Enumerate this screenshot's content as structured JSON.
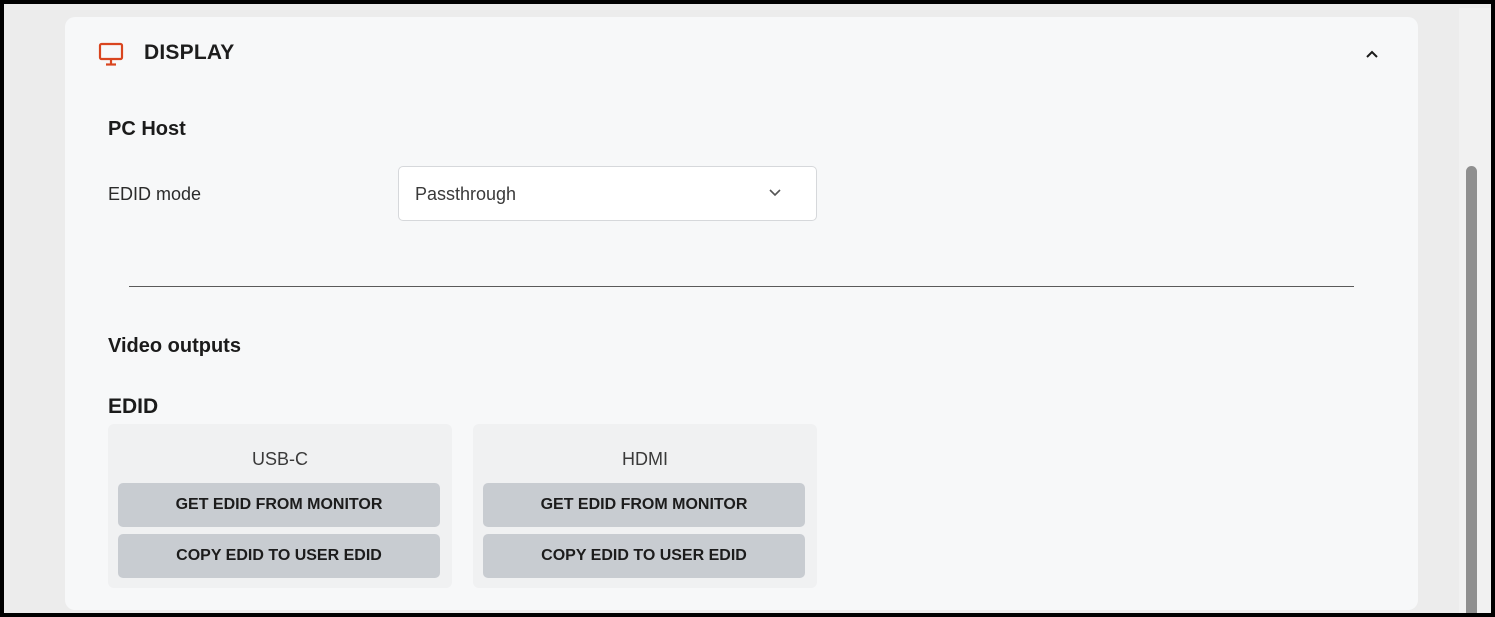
{
  "section": {
    "icon": "monitor-icon",
    "title": "DISPLAY",
    "accent_color": "#d9451f",
    "collapse_icon": "chevron-up-icon"
  },
  "pc_host": {
    "heading": "PC Host",
    "edid_mode_label": "EDID mode",
    "edid_mode_value": "Passthrough",
    "dropdown_icon": "chevron-down-icon"
  },
  "video_outputs": {
    "heading": "Video outputs",
    "edid_heading": "EDID",
    "ports": [
      {
        "name": "USB-C",
        "get_label": "GET EDID FROM MONITOR",
        "copy_label": "COPY EDID TO USER EDID"
      },
      {
        "name": "HDMI",
        "get_label": "GET EDID FROM MONITOR",
        "copy_label": "COPY EDID TO USER EDID"
      }
    ]
  }
}
